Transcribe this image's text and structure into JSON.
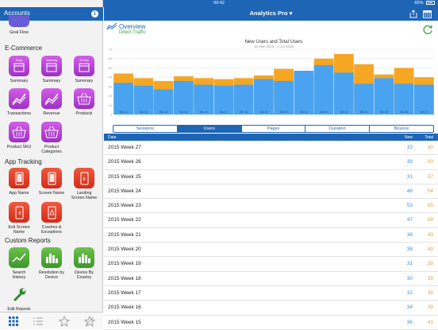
{
  "status_bar": {
    "device": "iPad",
    "time": "09:42",
    "battery": "65%"
  },
  "sidebar": {
    "title": "Accounts",
    "top_item": {
      "label": "Goal Flow"
    },
    "sections": [
      {
        "title": "E-Commerce",
        "items": [
          {
            "label": "Summary",
            "caption": "Today",
            "icon": "calendar-icon",
            "color": "purple"
          },
          {
            "label": "Summary",
            "caption": "Yesterday",
            "icon": "calendar-icon",
            "color": "purple"
          },
          {
            "label": "Summary",
            "caption": "30 Days",
            "icon": "calendar-icon",
            "color": "purple"
          },
          {
            "label": "Transactions",
            "icon": "trend-icon",
            "color": "purple"
          },
          {
            "label": "Revenue",
            "icon": "trend-icon",
            "color": "purple"
          },
          {
            "label": "Products",
            "icon": "basket-icon",
            "color": "purple"
          },
          {
            "label": "Product SKU",
            "icon": "basket-icon",
            "color": "purple"
          },
          {
            "label": "Product Categories",
            "icon": "basket-icon",
            "color": "purple"
          }
        ]
      },
      {
        "title": "App Tracking",
        "items": [
          {
            "label": "App Name",
            "icon": "phone-icon",
            "color": "red"
          },
          {
            "label": "Screen Name",
            "icon": "phone-icon",
            "color": "red"
          },
          {
            "label": "Landing Screen Name",
            "icon": "phone-icon",
            "color": "red"
          },
          {
            "label": "Exit Screen Name",
            "icon": "phone-icon",
            "color": "red"
          },
          {
            "label": "Crashes & Exceptions",
            "icon": "phone-icon",
            "color": "red"
          }
        ]
      },
      {
        "title": "Custom Reports",
        "items": [
          {
            "label": "Search History",
            "icon": "trend-icon",
            "color": "green"
          },
          {
            "label": "Resolution by Device",
            "icon": "bars-icon",
            "color": "green"
          },
          {
            "label": "Device By Country",
            "icon": "bars-icon",
            "color": "green"
          }
        ]
      }
    ],
    "edit_reports_label": "Edit Reports",
    "tabbar": [
      "grid-icon",
      "list-icon",
      "star-icon",
      "star-settings-icon"
    ]
  },
  "header": {
    "app_title": "Analytics Pro ▾"
  },
  "overview": {
    "title": "Overview",
    "subtitle": "Direct Traffic"
  },
  "chart_data": {
    "type": "bar",
    "title": "New Users and Total Users",
    "subtitle": "15 Mar 2015 - 4 Jul 2015",
    "categories": [
      "Wk 12",
      "Wk 13",
      "Wk 14",
      "Wk 15",
      "Wk 16",
      "Wk 17",
      "Wk 18",
      "Wk 19",
      "Wk 20",
      "Wk 21",
      "Wk 22",
      "Wk 23",
      "Wk 24",
      "Wk 25",
      "Wk 26",
      "Wk 27"
    ],
    "ylim": [
      0,
      70
    ],
    "yticks": [
      0,
      10,
      20,
      30,
      40,
      50,
      60,
      70
    ],
    "series": [
      {
        "name": "New",
        "color": "#4aa3f0",
        "values": [
          34,
          31,
          27,
          36,
          32,
          31,
          32,
          38,
          36,
          47,
          53,
          45,
          33,
          39,
          33,
          32
        ]
      },
      {
        "name": "Total",
        "color": "#f5a623",
        "values": [
          44,
          39,
          36,
          41,
          39,
          38,
          39,
          42,
          49,
          43,
          60,
          65,
          54,
          43,
          50,
          40
        ]
      }
    ],
    "grid": true
  },
  "segments": [
    {
      "label": "Sessions",
      "active": false
    },
    {
      "label": "Users",
      "active": true
    },
    {
      "label": "Pages",
      "active": false
    },
    {
      "label": "Duration",
      "active": false
    },
    {
      "label": "Bounce",
      "active": false
    }
  ],
  "table": {
    "headers": {
      "date": "Date",
      "new": "New",
      "total": "Total"
    },
    "rows": [
      {
        "week": "2015 Week 27",
        "new": "33",
        "total": "40"
      },
      {
        "week": "2015 Week 26",
        "new": "39",
        "total": "50"
      },
      {
        "week": "2015 Week 25",
        "new": "31",
        "total": "37"
      },
      {
        "week": "2015 Week 24",
        "new": "46",
        "total": "54"
      },
      {
        "week": "2015 Week 23",
        "new": "53",
        "total": "65"
      },
      {
        "week": "2015 Week 22",
        "new": "47",
        "total": "58"
      },
      {
        "week": "2015 Week 21",
        "new": "36",
        "total": "43"
      },
      {
        "week": "2015 Week 20",
        "new": "38",
        "total": "49"
      },
      {
        "week": "2015 Week 19",
        "new": "31",
        "total": "39"
      },
      {
        "week": "2015 Week 18",
        "new": "30",
        "total": "39"
      },
      {
        "week": "2015 Week 17",
        "new": "32",
        "total": "38"
      },
      {
        "week": "2015 Week 16",
        "new": "34",
        "total": "39"
      },
      {
        "week": "2015 Week 15",
        "new": "36",
        "total": "41"
      }
    ]
  }
}
